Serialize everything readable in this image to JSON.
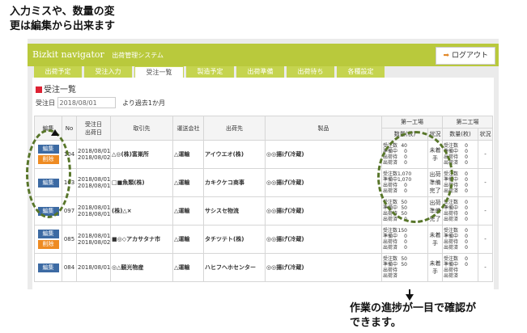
{
  "callouts": {
    "top_line1": "入力ミスや、数量の変",
    "top_line2": "更は編集から出来ます",
    "bottom_line1": "作業の進捗が一目で確認が",
    "bottom_line2": "できます。"
  },
  "header": {
    "brand": "Bizkit navigator",
    "subtitle": "出荷管理システム",
    "logout_label": "ログアウト",
    "color": "#b9c93c"
  },
  "tabs": [
    "出荷予定",
    "受注入力",
    "受注一覧",
    "製造予定",
    "出荷準備",
    "出荷待ち",
    "各種設定"
  ],
  "panel": {
    "title": "受注一覧",
    "filter_label": "受注日",
    "filter_value": "2018/08/01",
    "filter_suffix": "より過去1か月"
  },
  "table": {
    "headers": {
      "edit": "編集",
      "no": "No",
      "order_date": "受注日",
      "ship_date": "出荷日",
      "client": "取引先",
      "carrier": "運送会社",
      "destination": "出荷先",
      "product": "製品",
      "factory1": "第一工場",
      "factory2": "第二工場",
      "qty": "数量(枚)",
      "status": "状況"
    },
    "stat_labels": [
      "受注数",
      "準備中",
      "出荷待",
      "出荷済"
    ],
    "edit_label": "編集",
    "delete_label": "削除",
    "rows": [
      {
        "no": "104",
        "order_date": "2018/08/01",
        "ship_date": "2018/08/02",
        "client": "△◎(株)富巣所",
        "carrier": "△運輸",
        "dest": "アイウエオ(株)",
        "product": "◎◎揚げ(冷蔵)",
        "f1": [
          "40",
          "0",
          "0",
          "0"
        ],
        "f1_status": "未着手",
        "f2": [
          "0",
          "0",
          "0",
          "0"
        ],
        "f2_status": "-",
        "delete": true
      },
      {
        "no": "103",
        "order_date": "2018/08/01",
        "ship_date": "2018/08/01",
        "client": "□■魚類(株)",
        "carrier": "△運輸",
        "dest": "カキクケコ商事",
        "product": "◎◎揚げ(冷蔵)",
        "f1": [
          "1,070",
          "1,070",
          "0",
          "0"
        ],
        "f1_status": "出荷準備完了",
        "f2": [
          "0",
          "0",
          "0",
          "0"
        ],
        "f2_status": "-",
        "delete": false
      },
      {
        "no": "097",
        "order_date": "2018/08/01",
        "ship_date": "2018/08/01",
        "client": "(株)△×",
        "carrier": "△運輸",
        "dest": "サシスセ物流",
        "product": "◎◎揚げ(冷蔵)",
        "f1": [
          "50",
          "50",
          "50",
          "0"
        ],
        "f1_status": "出荷準備完了",
        "f2": [
          "0",
          "0",
          "0",
          "0"
        ],
        "f2_status": "-",
        "delete": false
      },
      {
        "no": "085",
        "order_date": "2018/08/01",
        "ship_date": "2018/08/02",
        "client": "■◎◇アカサタナ市",
        "carrier": "△運輸",
        "dest": "タチツテト(株)",
        "product": "◎◎揚げ(冷蔵)",
        "f1": [
          "150",
          "0",
          "0",
          "0"
        ],
        "f1_status": "未着手",
        "f2": [
          "0",
          "0",
          "0",
          "0"
        ],
        "f2_status": "-",
        "delete": true
      },
      {
        "no": "084",
        "order_date": "2018/08/01",
        "ship_date": "",
        "client": "◎△観光物産",
        "carrier": "△運輸",
        "dest": "ハヒフヘホセンター",
        "product": "◎◎揚げ(冷蔵)",
        "f1": [
          "50",
          "50",
          "",
          ""
        ],
        "f1_status": "未着手",
        "f2": [
          "0",
          "0",
          "",
          ""
        ],
        "f2_status": "-",
        "delete": false
      }
    ]
  },
  "colors": {
    "edit_button": "#3c6aa3",
    "delete_button": "#ee8b22",
    "highlight_circle": "#58762a"
  }
}
